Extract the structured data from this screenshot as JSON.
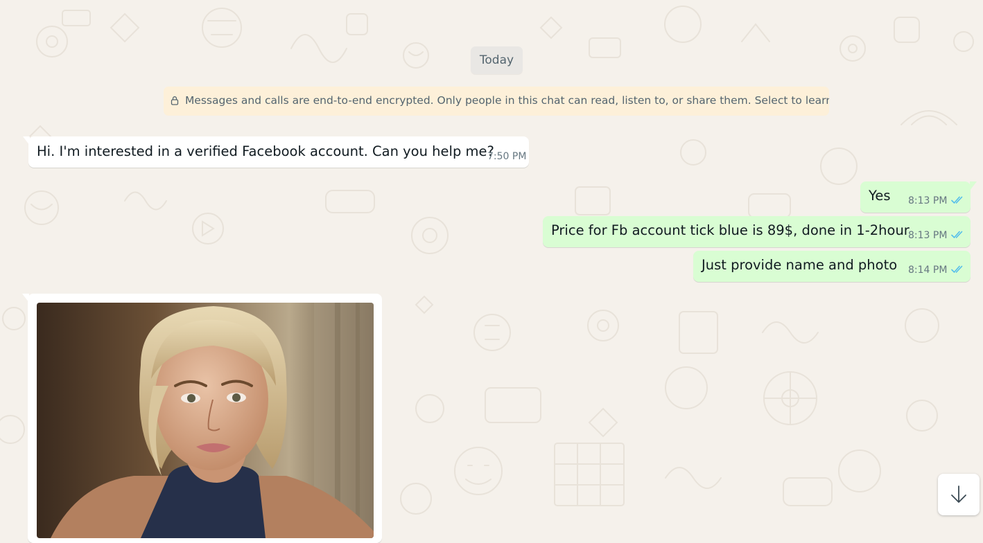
{
  "date_separator": "Today",
  "encryption_notice": "Messages and calls are end-to-end encrypted. Only people in this chat can read, listen to, or share them. Select to learn more.",
  "messages": [
    {
      "direction": "incoming",
      "text": "Hi. I'm interested in a verified Facebook account. Can you help me?",
      "time": "7:50 PM"
    },
    {
      "direction": "outgoing",
      "text": "Yes",
      "time": "8:13 PM",
      "status": "read"
    },
    {
      "direction": "outgoing",
      "text": "Price for Fb account tick blue is 89$, done in 1-2hour",
      "time": "8:13 PM",
      "status": "read"
    },
    {
      "direction": "outgoing",
      "text": "Just provide name and photo",
      "time": "8:14 PM",
      "status": "read"
    }
  ],
  "photo_message": {
    "direction": "incoming",
    "content": "photo"
  },
  "scroll_button": {
    "icon": "arrow-down-icon"
  },
  "colors": {
    "wallpaper": "#f5f1eb",
    "incoming_bubble": "#ffffff",
    "outgoing_bubble": "#d9fdd3",
    "notice_bg": "#fdf0d9",
    "read_ticks": "#53bdeb",
    "timestamp": "#667781"
  }
}
